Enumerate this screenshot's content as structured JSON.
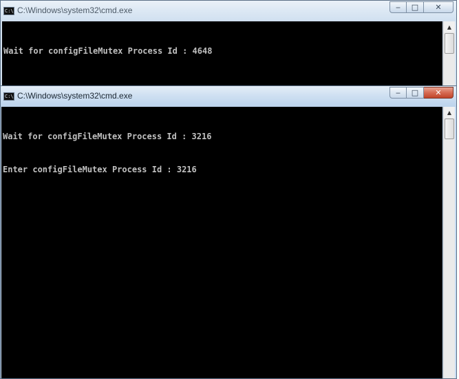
{
  "windows": [
    {
      "title": "C:\\Windows\\system32\\cmd.exe",
      "icon": "cmd-icon",
      "icon_text": "C:\\",
      "controls": {
        "minimize": "‒",
        "maximize": "□",
        "close": "✕"
      },
      "lines": [
        "Wait for configFileMutex Process Id : 4648"
      ]
    },
    {
      "title": "C:\\Windows\\system32\\cmd.exe",
      "icon": "cmd-icon",
      "icon_text": "C:\\",
      "controls": {
        "minimize": "‒",
        "maximize": "□",
        "close": "✕"
      },
      "lines": [
        "Wait for configFileMutex Process Id : 3216",
        "Enter configFileMutex Process Id : 3216"
      ]
    }
  ],
  "colors": {
    "console_bg": "#000000",
    "console_text": "#c0c0c0",
    "close_active": "#c84a31"
  },
  "scrollbar": {
    "up_arrow": "▲"
  }
}
